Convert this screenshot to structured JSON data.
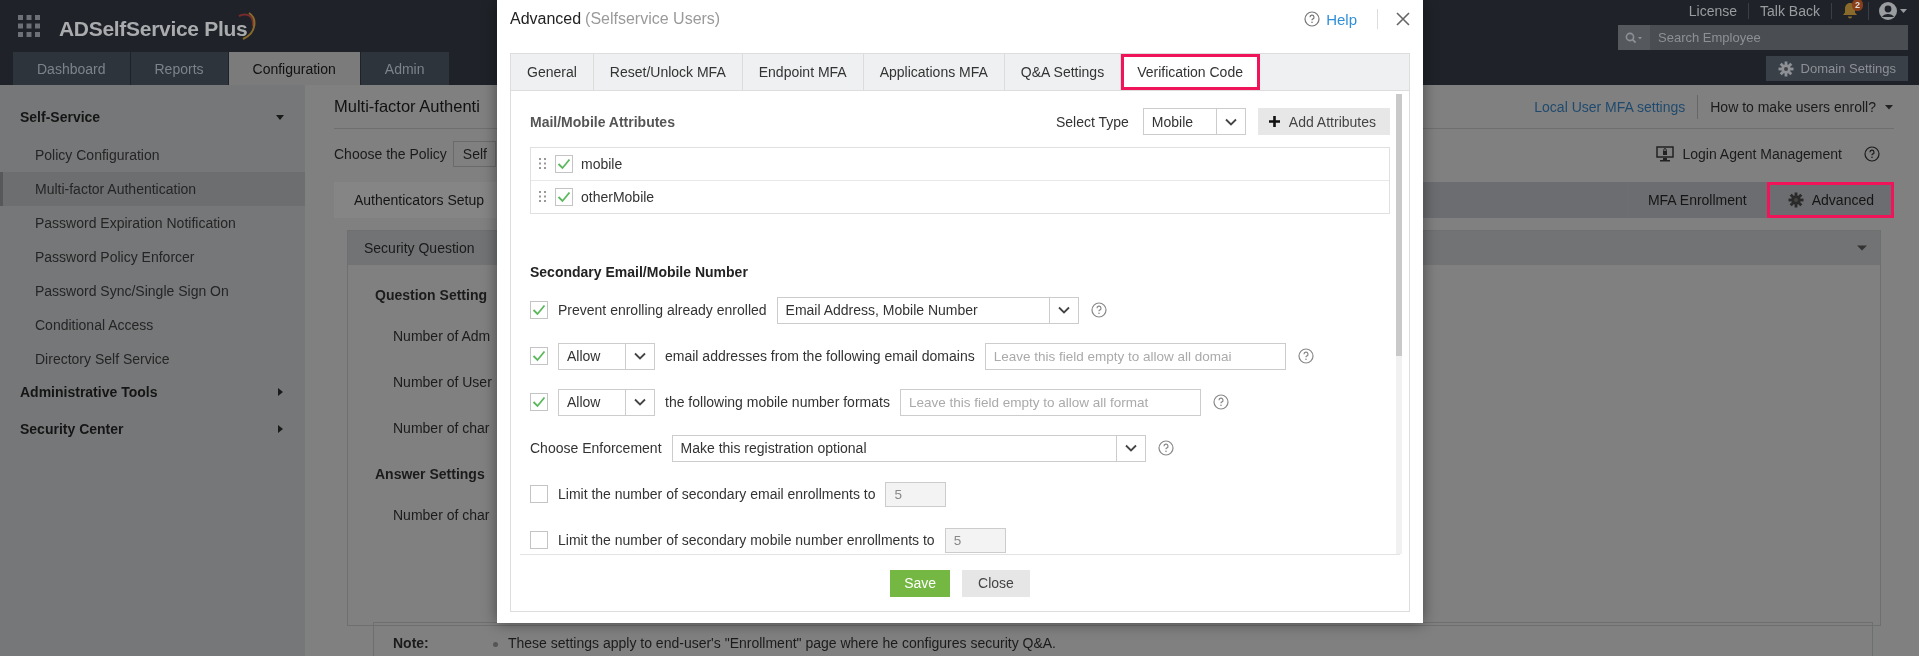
{
  "header": {
    "app_name": "ADSelfService Plus",
    "links": [
      "License",
      "Talk Back"
    ],
    "notification_count": "2",
    "search": {
      "placeholder": "Search Employee"
    },
    "domain_settings": "Domain Settings"
  },
  "nav_tabs": [
    {
      "label": "Dashboard",
      "selected": false
    },
    {
      "label": "Reports",
      "selected": false
    },
    {
      "label": "Configuration",
      "selected": true
    },
    {
      "label": "Admin",
      "selected": false
    }
  ],
  "sidebar": [
    {
      "label": "Self-Service",
      "expanded": true,
      "items": [
        {
          "label": "Policy Configuration",
          "selected": false
        },
        {
          "label": "Multi-factor Authentication",
          "selected": true
        },
        {
          "label": "Password Expiration Notification",
          "selected": false
        },
        {
          "label": "Password Policy Enforcer",
          "selected": false
        },
        {
          "label": "Password Sync/Single Sign On",
          "selected": false
        },
        {
          "label": "Conditional Access",
          "selected": false
        },
        {
          "label": "Directory Self Service",
          "selected": false
        }
      ]
    },
    {
      "label": "Administrative Tools",
      "expanded": false
    },
    {
      "label": "Security Center",
      "expanded": false
    }
  ],
  "page": {
    "title": "Multi-factor Authenti",
    "link": "Local User MFA settings",
    "help_menu": "How to make users enroll?",
    "policy_label": "Choose the Policy",
    "policy_value": "Self",
    "login_agent": "Login Agent Management",
    "tabs": [
      {
        "label": "Authenticators Setup",
        "selected": true,
        "highlighted": false
      },
      {
        "label": "MFA Enrollment",
        "selected": false,
        "highlighted": false
      },
      {
        "label": "Advanced",
        "selected": false,
        "highlighted": true
      }
    ],
    "panel_title": "Security Question",
    "sections": [
      {
        "heading": "Question Setting",
        "lines": [
          "Number of Adm",
          "Number of User",
          "Number of char"
        ]
      },
      {
        "heading": "Answer Settings",
        "lines": [
          "Number of char"
        ]
      }
    ],
    "note_label": "Note:",
    "note": "These settings apply to end-user's \"Enrollment\" page where he configures security Q&A."
  },
  "dialog": {
    "title": "Advanced",
    "subtitle": "(Selfservice Users)",
    "help": "Help",
    "tabs": [
      {
        "label": "General",
        "selected": false,
        "highlighted": false
      },
      {
        "label": "Reset/Unlock MFA",
        "selected": false,
        "highlighted": false
      },
      {
        "label": "Endpoint MFA",
        "selected": false,
        "highlighted": false
      },
      {
        "label": "Applications MFA",
        "selected": false,
        "highlighted": false
      },
      {
        "label": "Q&A Settings",
        "selected": false,
        "highlighted": false
      },
      {
        "label": "Verification Code",
        "selected": true,
        "highlighted": true
      }
    ],
    "attributes_heading": "Mail/Mobile Attributes",
    "select_type_label": "Select Type",
    "select_type_value": "Mobile",
    "add_button": "Add Attributes",
    "attributes": [
      {
        "label": "mobile",
        "checked": true
      },
      {
        "label": "otherMobile",
        "checked": true
      }
    ],
    "secondary_heading": "Secondary Email/Mobile Number",
    "rows": [
      {
        "kind": "check-select",
        "checked": true,
        "label": "Prevent enrolling already enrolled",
        "select": "Email Address, Mobile Number",
        "help": true
      },
      {
        "kind": "check-allow",
        "checked": true,
        "select": "Allow",
        "label": "email addresses from the following email domains",
        "placeholder": "Leave this field empty to allow all domai",
        "help": true
      },
      {
        "kind": "check-allow",
        "checked": true,
        "select": "Allow",
        "label": "the following mobile number formats",
        "placeholder": "Leave this field empty to allow all format",
        "help": true
      },
      {
        "kind": "label-select",
        "label": "Choose Enforcement",
        "select": "Make this registration optional",
        "help": true
      },
      {
        "kind": "check-number",
        "checked": false,
        "label": "Limit the number of secondary email enrollments to",
        "value": "5",
        "disabled": true,
        "help": false
      },
      {
        "kind": "check-number",
        "checked": false,
        "label": "Limit the number of secondary mobile number enrollments to",
        "value": "5",
        "disabled": true,
        "help": false
      }
    ],
    "buttons": [
      {
        "label": "Save",
        "kind": "primary"
      },
      {
        "label": "Close",
        "kind": "secondary"
      }
    ]
  }
}
